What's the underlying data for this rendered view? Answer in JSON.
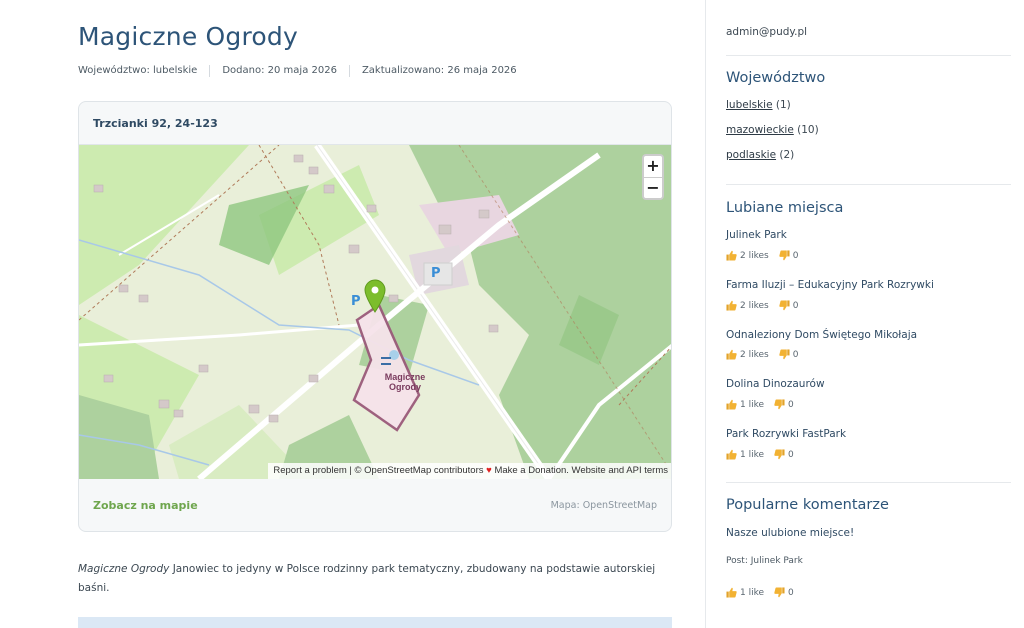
{
  "article": {
    "title": "Magiczne Ogrody",
    "meta": {
      "region": "Województwo: lubelskie",
      "added": "Dodano: 20 maja 2026",
      "updated": "Zaktualizowano: 26 maja 2026"
    },
    "description_lead": "Magiczne Ogrody",
    "description_rest": " Janowiec to jedyny w Polsce rodzinny park tematyczny, zbudowany na podstawie autorskiej baśni."
  },
  "map_card": {
    "address": "Trzcianki 92, 24-123",
    "zoom_in": "+",
    "zoom_out": "−",
    "attribution": {
      "report": "Report a problem",
      "osm": "| © OpenStreetMap contributors",
      "rest": "Make a Donation. Website and API terms"
    },
    "place_label_1": "Magiczne",
    "place_label_2": "Ogrody",
    "parking_label": "P",
    "see_on_map": "Zobacz na mapie",
    "map_source": "Mapa: OpenStreetMap"
  },
  "sidebar": {
    "email": "admin@pudy.pl",
    "regions_title": "Województwo",
    "regions": [
      {
        "name": "lubelskie",
        "count": "(1)"
      },
      {
        "name": "mazowieckie",
        "count": "(10)"
      },
      {
        "name": "podlaskie",
        "count": "(2)"
      }
    ],
    "liked_title": "Lubiane miejsca",
    "liked": [
      {
        "name": "Julinek Park",
        "likes": "2 likes",
        "dislikes": "0"
      },
      {
        "name": "Farma Iluzji – Edukacyjny Park Rozrywki",
        "likes": "2 likes",
        "dislikes": "0"
      },
      {
        "name": "Odnaleziony Dom Świętego Mikołaja",
        "likes": "2 likes",
        "dislikes": "0"
      },
      {
        "name": "Dolina Dinozaurów",
        "likes": "1 like",
        "dislikes": "0"
      },
      {
        "name": "Park Rozrywki FastPark",
        "likes": "1 like",
        "dislikes": "0"
      }
    ],
    "comments_title": "Popularne komentarze",
    "comment": {
      "text": "Nasze ulubione miejsce!",
      "post": "Post: Julinek Park",
      "likes": "1 like",
      "dislikes": "0"
    }
  },
  "colors": {
    "title": "#2d5478",
    "accent_green": "#6fa64e",
    "like_yellow": "#f2b233",
    "pin_green": "#7cbd2c",
    "map_forest": "#add19e",
    "map_field": "#cdebb0",
    "map_area_outline": "#9a5a7a"
  },
  "icons": {
    "like": "thumbs-up-icon",
    "dislike": "thumbs-down-icon",
    "marker": "map-marker-icon",
    "heart": "heart-icon"
  }
}
